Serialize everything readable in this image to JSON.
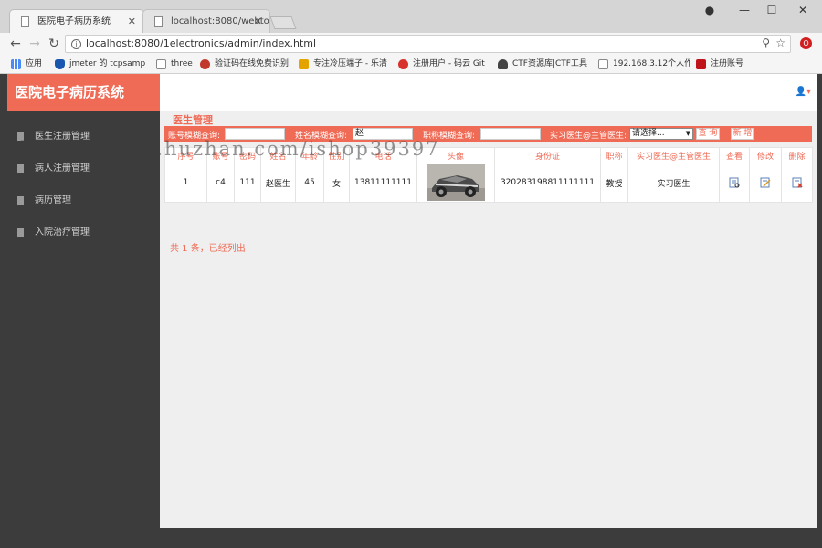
{
  "browser": {
    "tabs": [
      {
        "title": "医院电子病历系统"
      },
      {
        "title": "localhost:8080/webtoo"
      }
    ],
    "url": "localhost:8080/1electronics/admin/index.html",
    "bookmarks": [
      {
        "label": "应用",
        "color": "#4a8af4"
      },
      {
        "label": "jmeter 的 tcpsamp",
        "color": "#1a56b0"
      },
      {
        "label": "three",
        "color": "#888888"
      },
      {
        "label": "验证码在线免费识别",
        "color": "#c0392b"
      },
      {
        "label": "专注冷压端子 - 乐清",
        "color": "#e5a300"
      },
      {
        "label": "注册用户 - 码云 Git",
        "color": "#d7322c"
      },
      {
        "label": "CTF资源库|CTF工具",
        "color": "#444444"
      },
      {
        "label": "192.168.3.12个人作",
        "color": "#888888"
      },
      {
        "label": "注册账号",
        "color": "#c0141b"
      }
    ]
  },
  "app": {
    "brand": "医院电子病历系统",
    "sidebar": {
      "items": [
        {
          "label": "医生注册管理"
        },
        {
          "label": "病人注册管理"
        },
        {
          "label": "病历管理"
        },
        {
          "label": "入院治疗管理"
        }
      ]
    },
    "section_title": "医生管理",
    "filters": {
      "account_label": "账号模糊查询:",
      "account_value": "",
      "name_label": "姓名模糊查询:",
      "name_value": "赵",
      "title_label": "职称模糊查询:",
      "title_value": "",
      "role_label": "实习医生@主管医生:",
      "role_selected": "请选择...",
      "search_button": "查 询",
      "add_button": "新 增"
    },
    "table": {
      "headers": [
        "序号",
        "账号",
        "密码",
        "姓名",
        "年龄",
        "性别",
        "电话",
        "头像",
        "身份证",
        "职称",
        "实习医生@主管医生",
        "查看",
        "修改",
        "删除"
      ],
      "rows": [
        {
          "index": "1",
          "account": "c4",
          "password": "111",
          "name": "赵医生",
          "age": "45",
          "gender": "女",
          "phone": "13811111111",
          "id_card": "320283198811111111",
          "title": "教授",
          "role": "实习医生"
        }
      ]
    },
    "summary": "共 1 条，已经列出",
    "watermark": "https://www.huzhan.com/ishop39397",
    "colors": {
      "accent": "#ef6b56",
      "sidebar": "#3c3c3c"
    }
  }
}
